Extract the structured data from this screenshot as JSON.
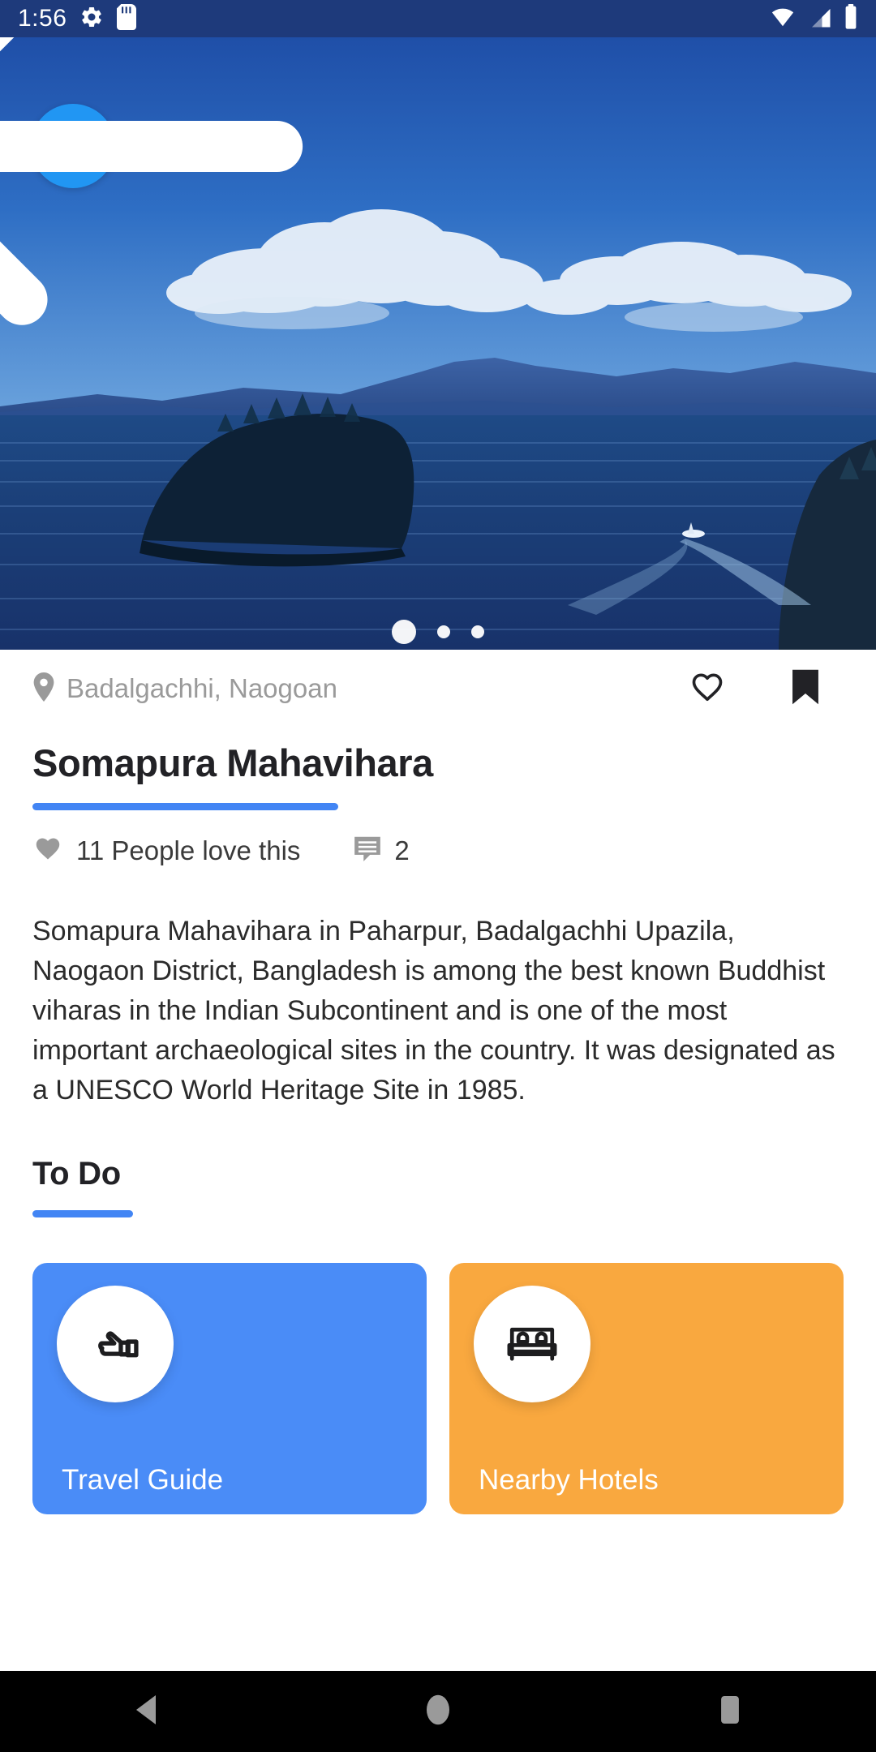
{
  "status_bar": {
    "time": "1:56",
    "left_icons": [
      "gear-icon",
      "sd-card-icon"
    ],
    "right_icons": [
      "wifi-icon",
      "cellular-signal-icon",
      "battery-icon"
    ],
    "background_color": "#1e3a7b"
  },
  "hero": {
    "back_button": {
      "icon": "back-arrow-icon",
      "color": "#2196f3"
    },
    "scene_description": "Seascape with forested island, distant mountains, clouds and boat wake",
    "carousel": {
      "total": 3,
      "active_index": 0
    }
  },
  "detail": {
    "location": "Badalgachhi, Naogoan",
    "location_icon": "map-pin-icon",
    "favorite_icon": "heart-outline-icon",
    "bookmark_icon": "bookmark-filled-icon",
    "title": "Somapura Mahavihara",
    "accent_color": "#4285f4",
    "likes_text": "11 People love this",
    "likes_icon": "heart-filled-icon",
    "comments_count": "2",
    "comments_icon": "comment-icon",
    "description": "Somapura Mahavihara in Paharpur, Badalgachhi Upazila, Naogaon District, Bangladesh is among the best known Buddhist viharas in the Indian Subcontinent and is one of the most important archaeological sites in the country. It was designated as a UNESCO World Heritage Site in 1985."
  },
  "todo": {
    "section_title": "To Do",
    "cards": [
      {
        "label": "Travel Guide",
        "icon": "pointing-hand-icon",
        "color": "#4a8cf7"
      },
      {
        "label": "Nearby Hotels",
        "icon": "bed-icon",
        "color": "#f9a83f"
      }
    ]
  },
  "navbar": {
    "back": "back-triangle-icon",
    "home": "home-circle-icon",
    "recents": "recents-square-icon"
  }
}
